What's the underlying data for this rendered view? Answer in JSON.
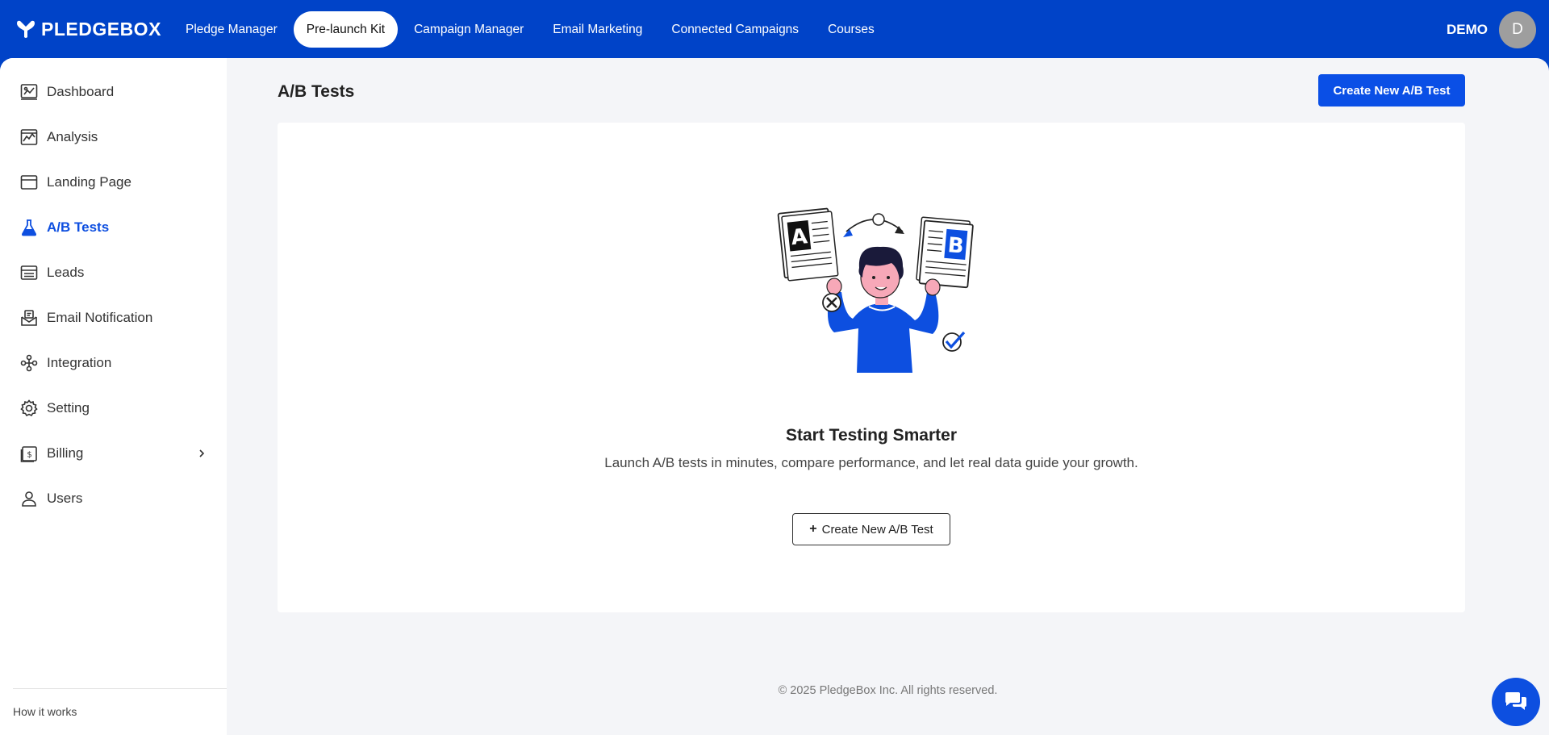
{
  "brand": {
    "name": "PLEDGEBOX"
  },
  "nav": {
    "items": [
      {
        "label": "Pledge Manager",
        "active": false
      },
      {
        "label": "Pre-launch Kit",
        "active": true
      },
      {
        "label": "Campaign Manager",
        "active": false
      },
      {
        "label": "Email Marketing",
        "active": false
      },
      {
        "label": "Connected Campaigns",
        "active": false
      },
      {
        "label": "Courses",
        "active": false
      }
    ]
  },
  "user": {
    "name": "DEMO",
    "initial": "D"
  },
  "sidebar": {
    "items": [
      {
        "label": "Dashboard",
        "icon": "dashboard-icon"
      },
      {
        "label": "Analysis",
        "icon": "analysis-icon"
      },
      {
        "label": "Landing Page",
        "icon": "landing-page-icon"
      },
      {
        "label": "A/B Tests",
        "icon": "flask-icon",
        "active": true
      },
      {
        "label": "Leads",
        "icon": "leads-icon"
      },
      {
        "label": "Email Notification",
        "icon": "email-notification-icon"
      },
      {
        "label": "Integration",
        "icon": "integration-icon"
      },
      {
        "label": "Setting",
        "icon": "gear-icon"
      },
      {
        "label": "Billing",
        "icon": "billing-icon",
        "expandable": true
      },
      {
        "label": "Users",
        "icon": "user-icon"
      }
    ],
    "how_it_works": "How it works"
  },
  "main": {
    "title": "A/B Tests",
    "create_button": "Create New A/B Test",
    "empty_state": {
      "title": "Start Testing Smarter",
      "description": "Launch A/B tests in minutes, compare performance, and let real data guide your growth.",
      "button": "Create New A/B Test"
    }
  },
  "footer": {
    "text": "© 2025 PledgeBox Inc. All rights reserved."
  },
  "colors": {
    "brand_blue": "#0043c8",
    "accent_blue": "#0a4fe6",
    "background": "#f4f5f8"
  }
}
